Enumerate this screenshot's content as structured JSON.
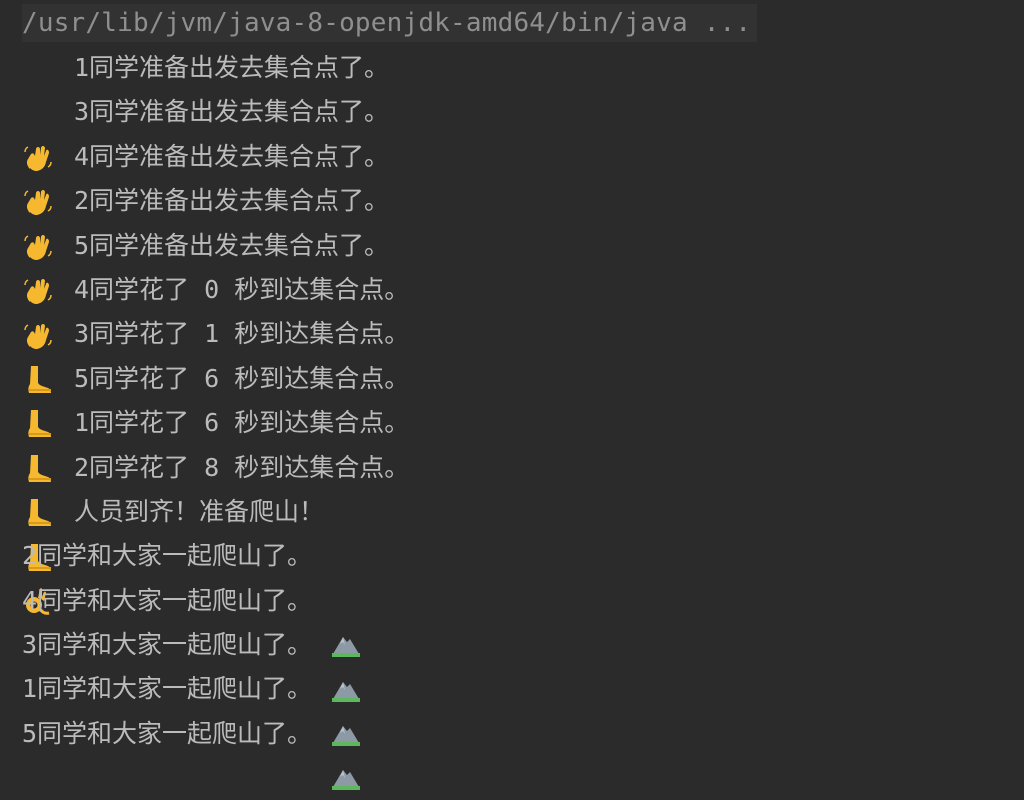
{
  "command": "/usr/lib/jvm/java-8-openjdk-amd64/bin/java ...",
  "lines": [
    {
      "icon": "waving-hand-icon",
      "text": "1同学准备出发去集合点了。"
    },
    {
      "icon": "waving-hand-icon",
      "text": "3同学准备出发去集合点了。"
    },
    {
      "icon": "waving-hand-icon",
      "text": "4同学准备出发去集合点了。"
    },
    {
      "icon": "waving-hand-icon",
      "text": "2同学准备出发去集合点了。"
    },
    {
      "icon": "waving-hand-icon",
      "text": "5同学准备出发去集合点了。"
    },
    {
      "icon": "foot-icon",
      "text": "4同学花了 0 秒到达集合点。"
    },
    {
      "icon": "foot-icon",
      "text": "3同学花了 1 秒到达集合点。"
    },
    {
      "icon": "foot-icon",
      "text": "5同学花了 6 秒到达集合点。"
    },
    {
      "icon": "foot-icon",
      "text": "1同学花了 6 秒到达集合点。"
    },
    {
      "icon": "foot-icon",
      "text": "2同学花了 8 秒到达集合点。"
    },
    {
      "icon": "ok-hand-icon",
      "text": "人员到齐！准备爬山！"
    },
    {
      "icon": "mountain-icon",
      "text": "2同学和大家一起爬山了。"
    },
    {
      "icon": "mountain-icon",
      "text": "4同学和大家一起爬山了。"
    },
    {
      "icon": "mountain-icon",
      "text": "3同学和大家一起爬山了。"
    },
    {
      "icon": "mountain-icon",
      "text": "1同学和大家一起爬山了。"
    },
    {
      "icon": "mountain-icon",
      "text": "5同学和大家一起爬山了。"
    }
  ],
  "colors": {
    "background": "#2b2b2b",
    "text": "#bbbbbb",
    "command_text": "#8f8f8f",
    "emoji_yellow": "#f5b82e",
    "mountain_gray": "#8d9aa6",
    "grass_green": "#5cb85c"
  }
}
